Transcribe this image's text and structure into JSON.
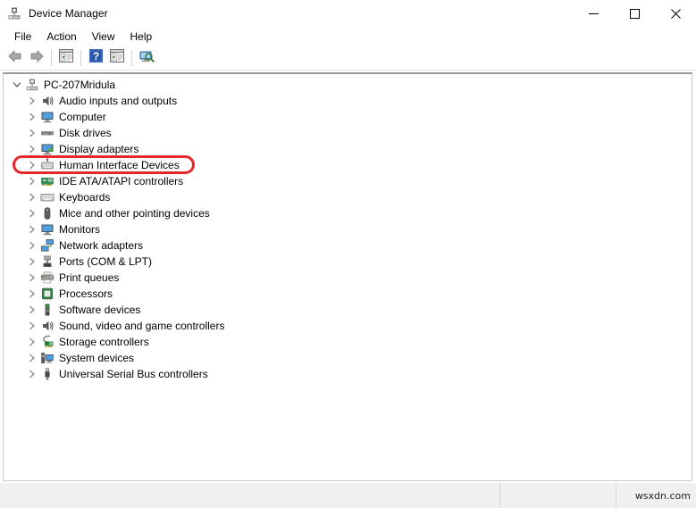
{
  "window": {
    "title": "Device Manager",
    "icon": "device-manager-icon",
    "controls": [
      {
        "name": "minimize-button",
        "glyph": "minimize"
      },
      {
        "name": "maximize-button",
        "glyph": "maximize"
      },
      {
        "name": "close-button",
        "glyph": "close"
      }
    ]
  },
  "menubar": {
    "items": [
      {
        "label": "File",
        "name": "menu-file"
      },
      {
        "label": "Action",
        "name": "menu-action"
      },
      {
        "label": "View",
        "name": "menu-view"
      },
      {
        "label": "Help",
        "name": "menu-help"
      }
    ]
  },
  "toolbar": {
    "buttons": [
      {
        "name": "back-button",
        "icon": "back-arrow-icon"
      },
      {
        "name": "forward-button",
        "icon": "forward-arrow-icon"
      },
      {
        "name": "show-hide-console-tree-button",
        "icon": "console-tree-icon"
      },
      {
        "name": "help-button",
        "icon": "question-mark-icon"
      },
      {
        "name": "properties-button",
        "icon": "properties-icon"
      },
      {
        "name": "scan-for-hardware-changes-button",
        "icon": "scan-hardware-icon"
      }
    ]
  },
  "tree": {
    "root": {
      "label": "PC-207Mridula",
      "icon": "computer-icon",
      "expanded": true
    },
    "items": [
      {
        "label": "Audio inputs and outputs",
        "icon": "speaker-icon"
      },
      {
        "label": "Computer",
        "icon": "monitor-icon"
      },
      {
        "label": "Disk drives",
        "icon": "disk-drive-icon"
      },
      {
        "label": "Display adapters",
        "icon": "display-adapter-icon"
      },
      {
        "label": "Human Interface Devices",
        "icon": "hid-icon",
        "highlighted": true
      },
      {
        "label": "IDE ATA/ATAPI controllers",
        "icon": "ide-controller-icon"
      },
      {
        "label": "Keyboards",
        "icon": "keyboard-icon"
      },
      {
        "label": "Mice and other pointing devices",
        "icon": "mouse-icon"
      },
      {
        "label": "Monitors",
        "icon": "monitor-icon"
      },
      {
        "label": "Network adapters",
        "icon": "network-adapter-icon"
      },
      {
        "label": "Ports (COM & LPT)",
        "icon": "port-icon"
      },
      {
        "label": "Print queues",
        "icon": "printer-icon"
      },
      {
        "label": "Processors",
        "icon": "processor-icon"
      },
      {
        "label": "Software devices",
        "icon": "software-device-icon"
      },
      {
        "label": "Sound, video and game controllers",
        "icon": "speaker-icon"
      },
      {
        "label": "Storage controllers",
        "icon": "storage-controller-icon"
      },
      {
        "label": "System devices",
        "icon": "system-device-icon"
      },
      {
        "label": "Universal Serial Bus controllers",
        "icon": "usb-icon"
      }
    ]
  },
  "annotation": {
    "target": "Human Interface Devices",
    "color": "#e5272b",
    "shape": "rounded-rectangle"
  },
  "statusbar": {
    "pane1": "",
    "pane2": "",
    "watermark": "wsxdn.com"
  }
}
